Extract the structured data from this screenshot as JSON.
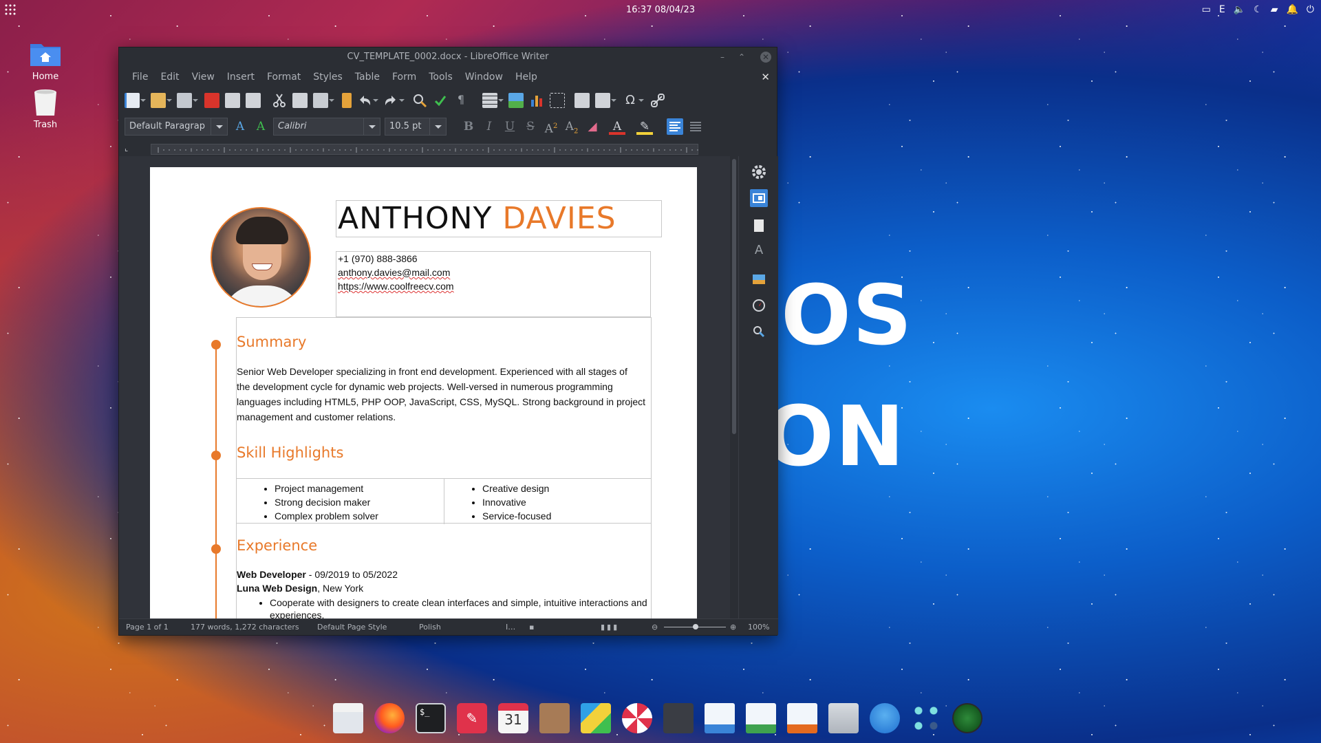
{
  "panel": {
    "clock": "16:37 08/04/23",
    "tray": [
      "screen-icon",
      "keyboard-layout-icon",
      "volume-icon",
      "night-mode-icon",
      "folder-icon",
      "notifications-icon",
      "power-icon"
    ]
  },
  "desktop": {
    "icons": [
      {
        "label": "Home",
        "icon": "home-folder-icon"
      },
      {
        "label": "Trash",
        "icon": "trash-icon"
      }
    ],
    "wallpaper_text": [
      "OS",
      "ON"
    ]
  },
  "window": {
    "title": "CV_TEMPLATE_0002.docx - LibreOffice Writer",
    "menu": [
      "File",
      "Edit",
      "View",
      "Insert",
      "Format",
      "Styles",
      "Table",
      "Form",
      "Tools",
      "Window",
      "Help"
    ],
    "format_bar": {
      "paragraph_style": "Default Paragrap",
      "font_name": "Calibri",
      "font_size": "10.5 pt"
    },
    "status": {
      "page": "Page 1 of 1",
      "words": "177 words, 1,272 characters",
      "page_style": "Default Page Style",
      "language": "Polish",
      "zoom": "100%"
    }
  },
  "document": {
    "first_name": "ANTHONY",
    "last_name": "DAVIES",
    "phone": "+1 (970) 888-3866",
    "email": "anthony.davies@mail.com",
    "website": "https://www.coolfreecv.com",
    "summary_title": "Summary",
    "summary_lines": [
      "Senior Web Developer specializing in front end development. Experienced with all stages of",
      "the development cycle for dynamic web projects. Well-versed in numerous programming",
      "languages including HTML5, PHP OOP, JavaScript, CSS, MySQL. Strong background in project",
      "management and customer relations."
    ],
    "skills_title": "Skill Highlights",
    "skills_left": [
      "Project management",
      "Strong decision maker",
      "Complex problem solver"
    ],
    "skills_right": [
      "Creative design",
      "Innovative",
      "Service-focused"
    ],
    "experience_title": "Experience",
    "job_title": "Web Developer",
    "job_dates": " - 09/2019 to 05/2022",
    "company": "Luna Web Design",
    "company_location": ", New York",
    "job_bullets": [
      "Cooperate with designers to create clean interfaces and simple, intuitive interactions and experiences."
    ]
  },
  "dock": [
    "files-icon",
    "firefox-icon",
    "terminal-icon",
    "text-editor-icon",
    "calendar-icon",
    "contacts-icon",
    "store-icon",
    "help-icon",
    "video-icon",
    "writer-icon",
    "calc-icon",
    "impress-icon",
    "software-center-icon",
    "mail-icon",
    "apps-icon",
    "system-monitor-icon"
  ],
  "calendar_day": "31"
}
